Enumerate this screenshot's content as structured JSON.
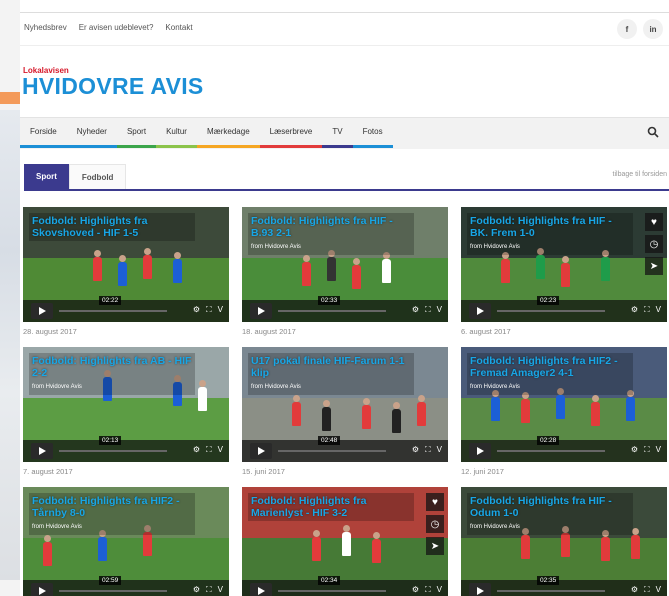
{
  "topbar": {
    "links": [
      "Nyhedsbrev",
      "Er avisen udeblevet?",
      "Kontakt"
    ],
    "social": [
      {
        "icon": "facebook-icon",
        "glyph": "f"
      },
      {
        "icon": "linkedin-icon",
        "glyph": "in"
      }
    ]
  },
  "logo": {
    "kicker": "Lokalavisen",
    "title": "HVIDOVRE AVIS",
    "kicker_color": "#d6182a",
    "title_color": "#1c8fd6"
  },
  "nav": {
    "items": [
      {
        "label": "Forside",
        "color": "#1c8fd6"
      },
      {
        "label": "Nyheder",
        "color": "#1c8fd6"
      },
      {
        "label": "Sport",
        "color": "#3ba54b"
      },
      {
        "label": "Kultur",
        "color": "#8bc34a"
      },
      {
        "label": "Mærkedage",
        "color": "#f5a623"
      },
      {
        "label": "Læserbreve",
        "color": "#e23b3b"
      },
      {
        "label": "TV",
        "color": "#3b3a8e"
      },
      {
        "label": "Fotos",
        "color": "#1c8fd6"
      }
    ],
    "search_icon": "search-icon"
  },
  "tabs": {
    "active": "Sport",
    "inactive": "Fodbold",
    "back_link": "tilbage til forsiden"
  },
  "videos": [
    {
      "title": "Fodbold: Highlights fra Skovshoved - HIF 1-5",
      "from": "",
      "time": "02:22",
      "date": "28. august 2017",
      "side_icons": false
    },
    {
      "title": "Fodbold: Highlights fra HIF - B.93 2-1",
      "from": "from Hvidovre Avis",
      "time": "02:33",
      "date": "18. august 2017",
      "side_icons": false
    },
    {
      "title": "Fodbold: Highlights fra HIF - BK. Frem 1-0",
      "from": "from Hvidovre Avis",
      "time": "02:23",
      "date": "6. august 2017",
      "side_icons": true
    },
    {
      "title": "Fodbold: Highlights fra AB - HIF 2-2",
      "from": "from Hvidovre Avis",
      "time": "02:13",
      "date": "7. august 2017",
      "side_icons": false
    },
    {
      "title": "U17 pokal finale HIF-Farum 1-1 klip",
      "from": "from Hvidovre Avis",
      "time": "02:48",
      "date": "15. juni 2017",
      "side_icons": false
    },
    {
      "title": "Fodbold: Highlights fra HIF2 - Fremad Amager2 4-1",
      "from": "from Hvidovre Avis",
      "time": "02:28",
      "date": "12. juni 2017",
      "side_icons": false
    },
    {
      "title": "Fodbold: Highlights fra HIF2 - Tårnby 8-0",
      "from": "from Hvidovre Avis",
      "time": "02:59",
      "date": "",
      "side_icons": false
    },
    {
      "title": "Fodbold: Highlights fra Marienlyst - HIF 3-2",
      "from": "",
      "time": "02:34",
      "date": "",
      "side_icons": true
    },
    {
      "title": "Fodbold: Highlights fra HIF - Odum 1-0",
      "from": "from Hvidovre Avis",
      "time": "02:35",
      "date": "",
      "side_icons": false
    }
  ]
}
